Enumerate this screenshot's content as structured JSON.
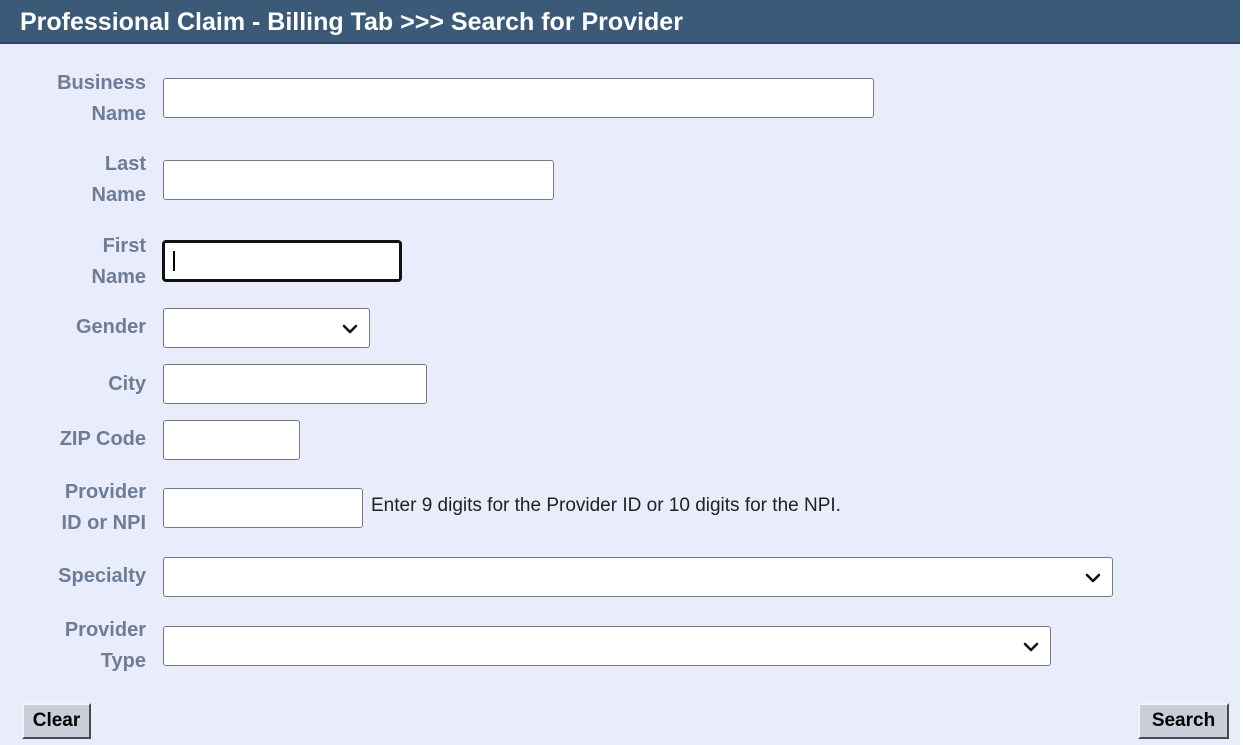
{
  "header": {
    "title": "Professional Claim - Billing Tab >>> Search for Provider"
  },
  "form": {
    "business_name": {
      "label_line1": "Business",
      "label_line2": "Name",
      "value": ""
    },
    "last_name": {
      "label_line1": "Last",
      "label_line2": "Name",
      "value": ""
    },
    "first_name": {
      "label_line1": "First",
      "label_line2": "Name",
      "value": ""
    },
    "gender": {
      "label": "Gender",
      "selected": ""
    },
    "city": {
      "label": "City",
      "value": ""
    },
    "zip_code": {
      "label": "ZIP Code",
      "value": ""
    },
    "provider_id": {
      "label_line1": "Provider",
      "label_line2": "ID or NPI",
      "value": "",
      "hint": "Enter 9 digits for the Provider ID or 10 digits for the NPI."
    },
    "specialty": {
      "label": "Specialty",
      "selected": ""
    },
    "provider_type": {
      "label_line1": "Provider",
      "label_line2": "Type",
      "selected": ""
    }
  },
  "buttons": {
    "clear_label": "Clear",
    "search_label": "Search"
  },
  "icons": {
    "dropdown": "chevron-down-icon"
  },
  "colors": {
    "header_bg": "#3a5a78",
    "form_bg": "#e9edfb",
    "label_text": "#6e7d96",
    "button_bg": "#c9ced8"
  }
}
